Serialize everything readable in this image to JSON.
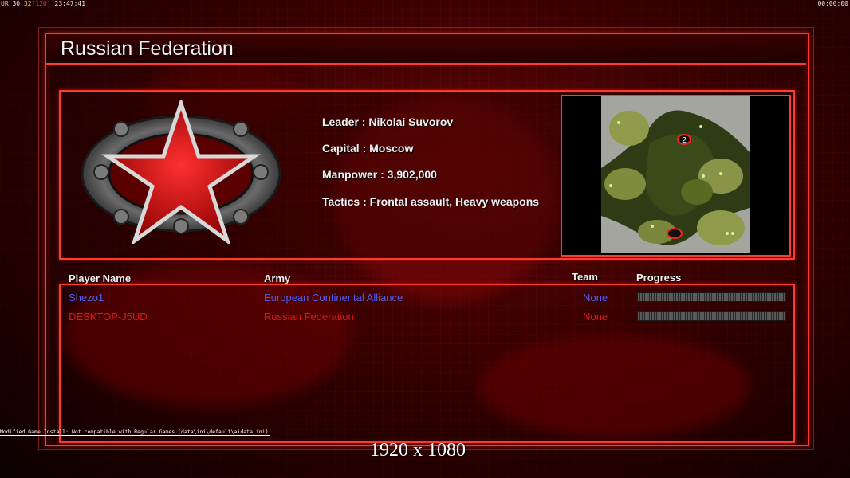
{
  "hud": {
    "left_prefix": "UR",
    "fps_a": "30",
    "fps_b": "32",
    "fps_c": "[120]",
    "clock": "23:47:41",
    "timer": "00:00:00"
  },
  "screen_title": "Russian Federation",
  "faction": {
    "emblem": "red-star-emblem",
    "leader": "Leader : Nikolai Suvorov",
    "capital": "Capital : Moscow",
    "manpower": "Manpower : 3,902,000",
    "tactics": "Tactics : Frontal assault, Heavy weapons"
  },
  "map": {
    "start_marker_label": "2"
  },
  "players_table": {
    "headers": {
      "player_name": "Player Name",
      "army": "Army",
      "team": "Team",
      "progress": "Progress"
    },
    "rows": [
      {
        "name": "Shezo1",
        "army": "European Continental Alliance",
        "team": "None",
        "progress": 0,
        "color": "#4d5ff0"
      },
      {
        "name": "DESKTOP-J5UD",
        "army": "Russian Federation",
        "team": "None",
        "progress": 0,
        "color": "#e01818"
      }
    ]
  },
  "footer": {
    "mod_notice": "Modified Game Install: Not compatible with Regular Games (data\\ini\\default\\aidata.ini)",
    "resolution": "1920 x 1080"
  },
  "colors": {
    "accent": "#ff3a2e",
    "player_blue": "#4d5ff0",
    "player_red": "#e01818"
  }
}
